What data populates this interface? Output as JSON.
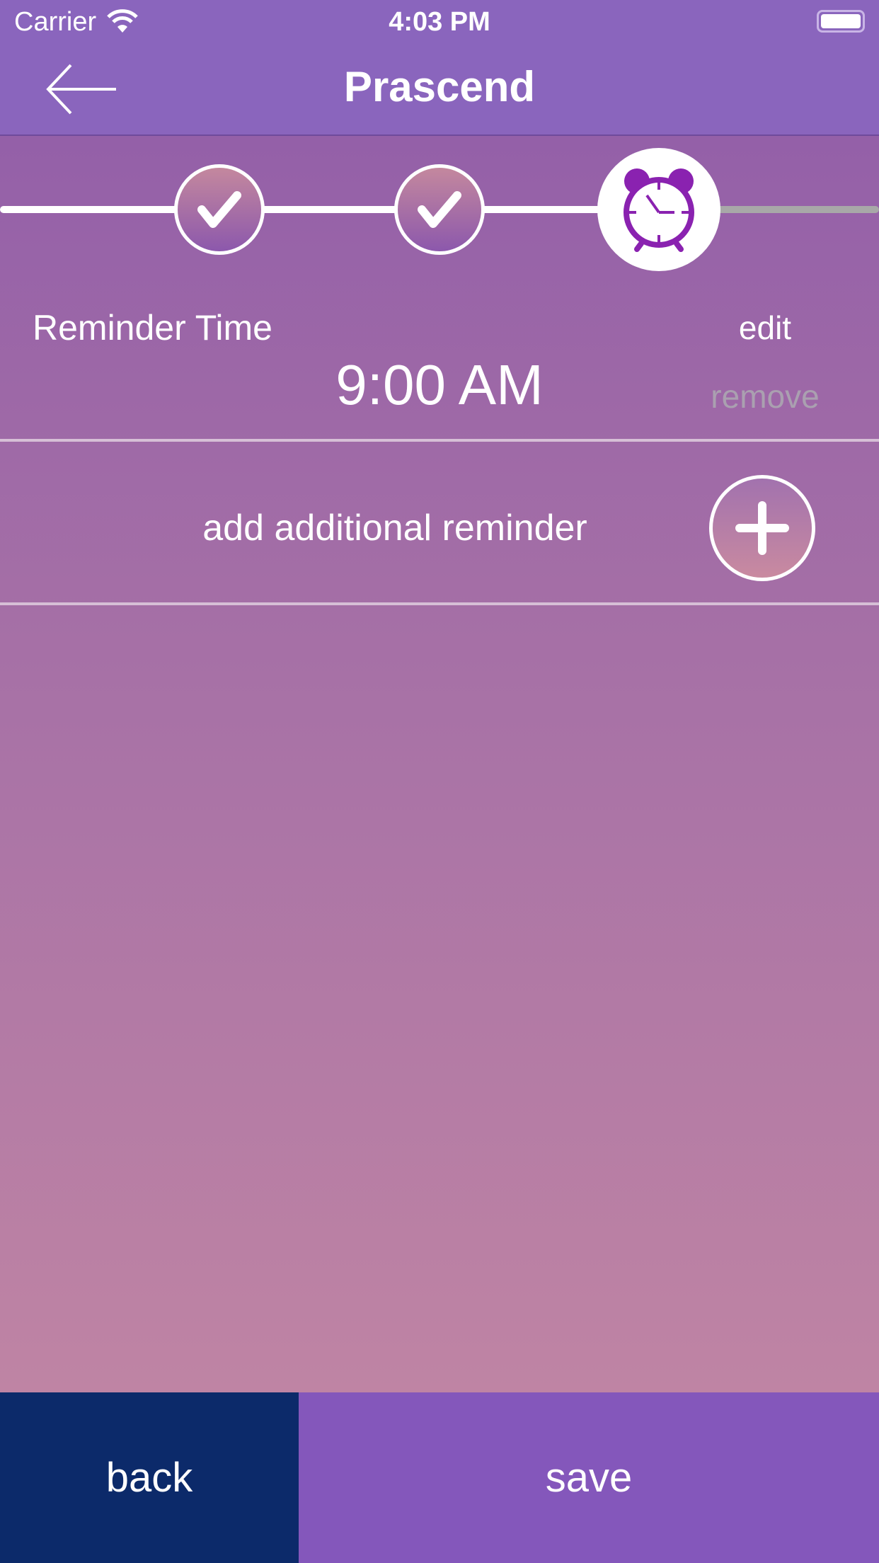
{
  "status_bar": {
    "carrier": "Carrier",
    "time": "4:03 PM",
    "battery_level": 1.0
  },
  "nav": {
    "title": "Prascend",
    "back_icon": "arrow-left-icon"
  },
  "progress": {
    "steps": [
      {
        "state": "complete",
        "icon": "check-icon"
      },
      {
        "state": "complete",
        "icon": "check-icon"
      },
      {
        "state": "current",
        "icon": "alarm-clock-icon"
      }
    ],
    "accent": "#8a22b0"
  },
  "reminder": {
    "label": "Reminder Time",
    "time": "9:00 AM",
    "edit_label": "edit",
    "remove_label": "remove"
  },
  "add_reminder": {
    "label": "add additional reminder",
    "icon": "plus-icon"
  },
  "footer": {
    "back_label": "back",
    "save_label": "save",
    "back_color": "#0c2a6a",
    "save_color": "#8457bb"
  }
}
